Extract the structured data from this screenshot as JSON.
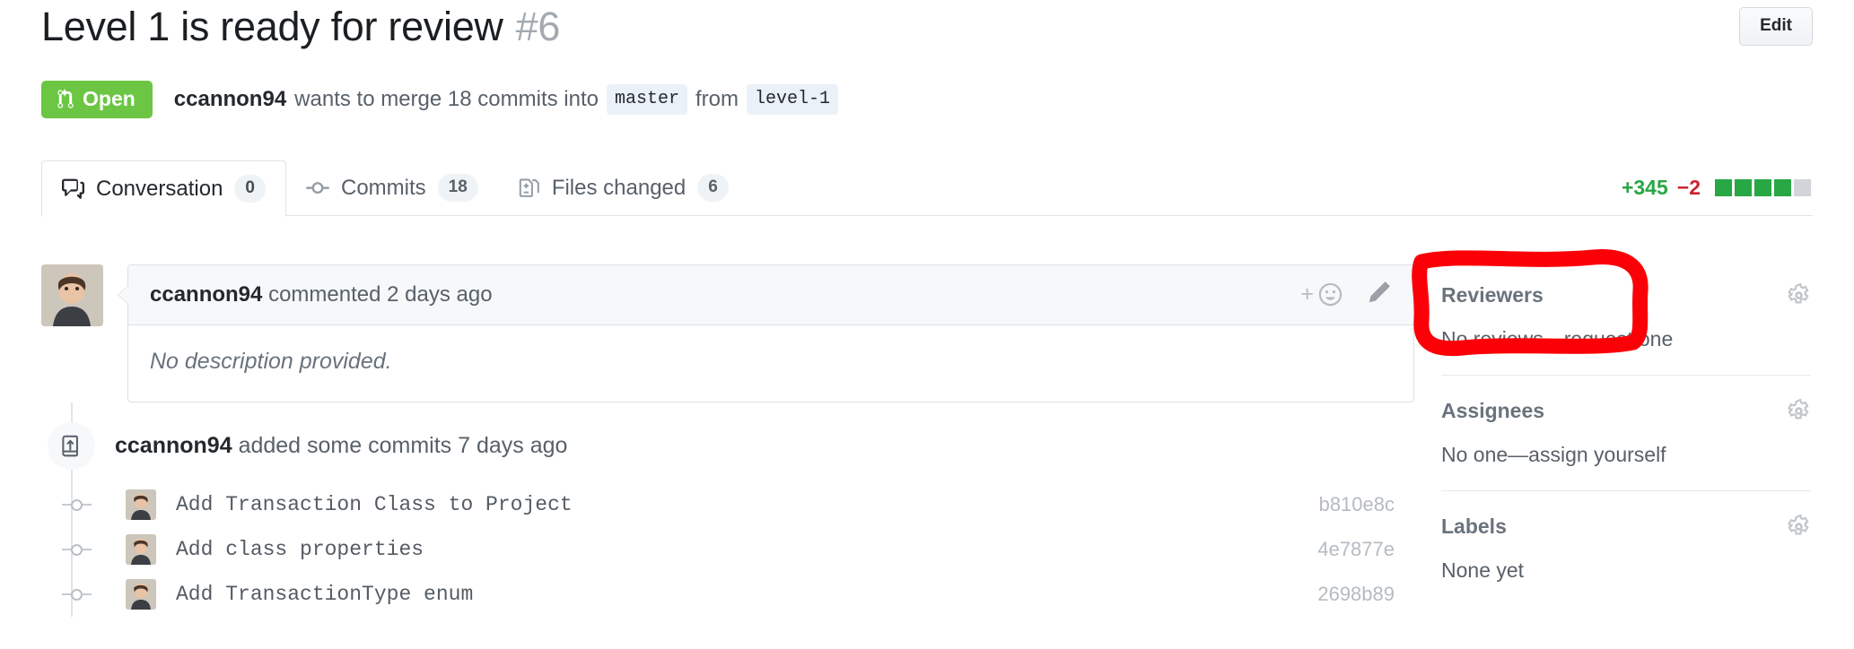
{
  "header": {
    "title": "Level 1 is ready for review",
    "number": "#6",
    "edit_label": "Edit"
  },
  "status": {
    "state_label": "Open",
    "state_icon": "git-pull-request-icon",
    "state_color": "#6cc644",
    "author": "ccannon94",
    "action_text": "wants to merge 18 commits into",
    "base_branch": "master",
    "from_text": "from",
    "head_branch": "level-1"
  },
  "tabs": [
    {
      "label": "Conversation",
      "count": "0",
      "icon": "comment-discussion-icon",
      "active": true
    },
    {
      "label": "Commits",
      "count": "18",
      "icon": "git-commit-icon",
      "active": false
    },
    {
      "label": "Files changed",
      "count": "6",
      "icon": "diff-file-icon",
      "active": false
    }
  ],
  "diffstat": {
    "added": "+345",
    "deleted": "−2",
    "blocks": [
      "#28a745",
      "#28a745",
      "#28a745",
      "#28a745",
      "#d1d5da"
    ]
  },
  "comment": {
    "author": "ccannon94",
    "action": "commented",
    "timestamp": "2 days ago",
    "body": "No description provided.",
    "reaction_icon": "add-reaction-icon",
    "edit_icon": "pencil-icon"
  },
  "timeline_event": {
    "icon": "repo-push-icon",
    "author": "ccannon94",
    "text": "added some commits",
    "timestamp": "7 days ago"
  },
  "commits": [
    {
      "message": "Add Transaction Class to Project",
      "sha": "b810e8c"
    },
    {
      "message": "Add class properties",
      "sha": "4e7877e"
    },
    {
      "message": "Add TransactionType enum",
      "sha": "2698b89"
    }
  ],
  "sidebar": [
    {
      "title": "Reviewers",
      "value": "No reviews—request one",
      "gear": "gear-icon"
    },
    {
      "title": "Assignees",
      "value": "No one—assign yourself",
      "gear": "gear-icon"
    },
    {
      "title": "Labels",
      "value": "None yet",
      "gear": "gear-icon"
    }
  ],
  "annotation": {
    "shape": "hand-drawn-rectangle",
    "color": "#fb0007",
    "targets": "Reviewers section"
  }
}
